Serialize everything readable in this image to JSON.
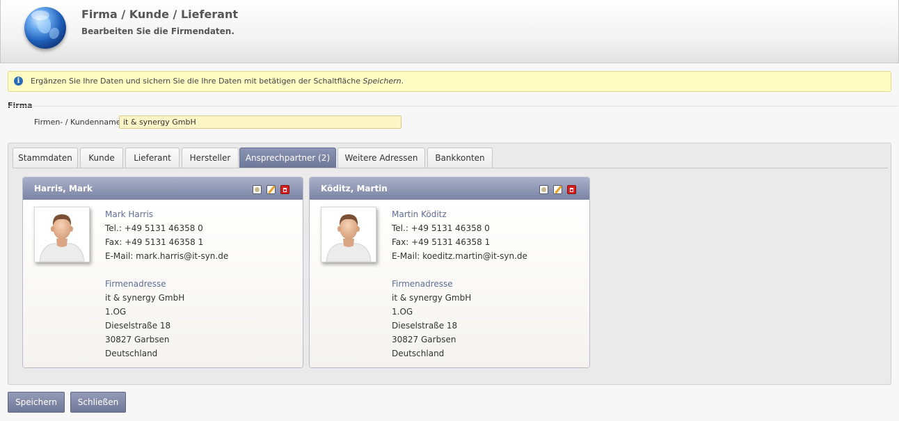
{
  "header": {
    "title": "Firma / Kunde / Lieferant",
    "subtitle": "Bearbeiten Sie die Firmendaten."
  },
  "info": {
    "text_before": "Ergänzen Sie Ihre Daten und sichern Sie die Ihre Daten mit betätigen der Schaltfläche ",
    "emphasis": "Speichern",
    "text_after": "."
  },
  "firma": {
    "section_title": "Firma",
    "name_label": "Firmen- / Kundenname",
    "name_value": "it & synergy GmbH"
  },
  "tabs": [
    {
      "label": "Stammdaten"
    },
    {
      "label": "Kunde"
    },
    {
      "label": "Lieferant"
    },
    {
      "label": "Hersteller"
    },
    {
      "label": "Ansprechpartner (2)",
      "active": true
    },
    {
      "label": "Weitere Adressen"
    },
    {
      "label": "Bankkonten"
    }
  ],
  "contacts": [
    {
      "header": "Harris, Mark",
      "full_name": "Mark Harris",
      "tel": "Tel.: +49 5131 46358 0",
      "fax": "Fax: +49 5131 46358 1",
      "email": "E-Mail: mark.harris@it-syn.de",
      "address_label": "Firmenadresse",
      "address": [
        "it & synergy GmbH",
        "1.OG",
        "Dieselstraße 18",
        "30827 Garbsen",
        "Deutschland"
      ]
    },
    {
      "header": "Köditz, Martin",
      "full_name": "Martin Köditz",
      "tel": "Tel.: +49 5131 46358 0",
      "fax": "Fax: +49 5131 46358 1",
      "email": "E-Mail: koeditz.martin@it-syn.de",
      "address_label": "Firmenadresse",
      "address": [
        "it & synergy GmbH",
        "1.OG",
        "Dieselstraße 18",
        "30827 Garbsen",
        "Deutschland"
      ]
    }
  ],
  "card_actions": [
    "details-icon",
    "edit-icon",
    "delete-icon"
  ],
  "buttons": {
    "save": "Speichern",
    "close": "Schließen"
  },
  "colors": {
    "accent": "#7a83a5",
    "info_bg": "#fffcc4",
    "input_bg": "#fff6c8",
    "link_text": "#5f6d96"
  }
}
